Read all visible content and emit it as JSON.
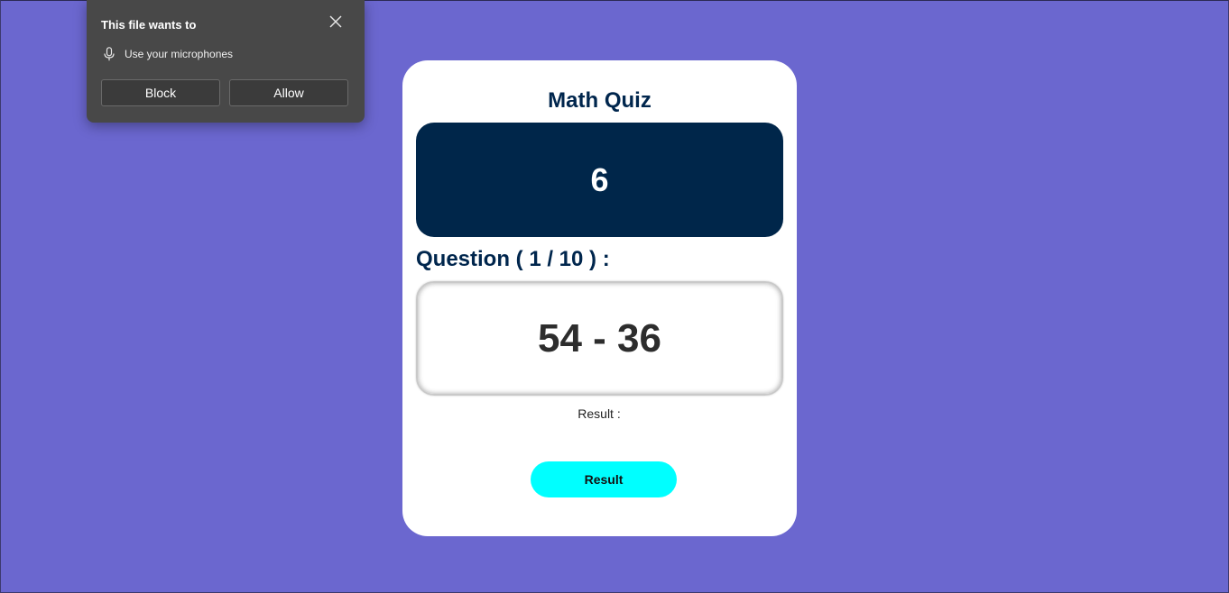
{
  "permission_popup": {
    "title": "This file wants to",
    "permission_text": "Use your microphones",
    "block_label": "Block",
    "allow_label": "Allow",
    "icons": {
      "close": "close-icon",
      "microphone": "microphone-icon"
    }
  },
  "quiz": {
    "title": "Math Quiz",
    "score": "6",
    "question_label": "Question ( 1 / 10 ) :",
    "question": "54 - 36",
    "result_label": "Result :",
    "result_button_label": "Result"
  },
  "colors": {
    "background": "#6b67cf",
    "card": "#ffffff",
    "score_box": "#00264a",
    "heading_text": "#00264d",
    "result_button": "#00ffff",
    "popup_bg": "#484848"
  }
}
